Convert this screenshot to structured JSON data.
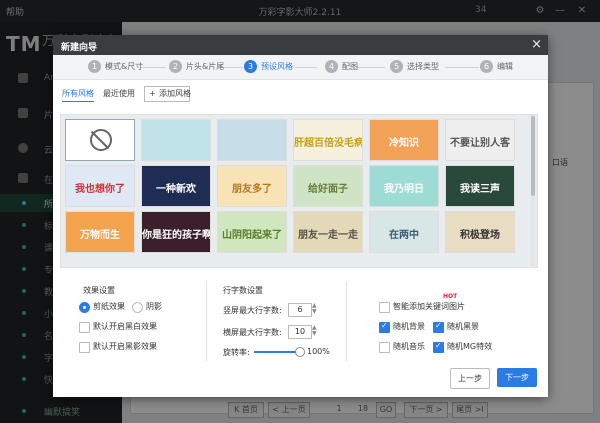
{
  "titlebar": {
    "menu": "帮助",
    "app_title": "万彩字影大师2.2.11",
    "account": "34"
  },
  "sidebar": {
    "logo": "TM",
    "logo_text": "万彩字影大师",
    "items": [
      {
        "label": "Ar"
      },
      {
        "label": "片"
      },
      {
        "label": "云"
      },
      {
        "label": "在"
      }
    ],
    "sub_items": [
      {
        "label": "所"
      },
      {
        "label": "标"
      },
      {
        "label": "课"
      },
      {
        "label": "专"
      },
      {
        "label": "教"
      },
      {
        "label": "小"
      },
      {
        "label": "名"
      },
      {
        "label": "字"
      },
      {
        "label": "快"
      },
      {
        "label": "幽默搞笑"
      }
    ]
  },
  "background": {
    "tag": "口语",
    "pager": {
      "first": "K 首页",
      "prev": "< 上一页",
      "page": "1",
      "total": "18",
      "go": "GO",
      "next": "下一页 >",
      "last": "尾页 >I"
    }
  },
  "dialog": {
    "title": "新建向导",
    "close": "×",
    "steps": [
      {
        "num": "1",
        "label": "模式&尺寸",
        "active": false
      },
      {
        "num": "2",
        "label": "片头&片尾",
        "active": false
      },
      {
        "num": "3",
        "label": "预设风格",
        "active": true
      },
      {
        "num": "4",
        "label": "配图",
        "active": false
      },
      {
        "num": "5",
        "label": "选择类型",
        "active": false
      },
      {
        "num": "6",
        "label": "编辑",
        "active": false
      }
    ],
    "tabs": {
      "all": "所有风格",
      "recent": "最近使用",
      "add": "添加风格",
      "add_icon": "+"
    },
    "thumbnails": [
      {
        "text": "",
        "bg": "#ffffff",
        "color": "#666",
        "none": true
      },
      {
        "text": "",
        "bg": "#bfe3e8",
        "color": "#466"
      },
      {
        "text": "",
        "bg": "#c7dde8",
        "color": "#466"
      },
      {
        "text": "肝超百倍没毛病",
        "bg": "#f6f1dc",
        "color": "#c7a017"
      },
      {
        "text": "冷知识",
        "bg": "#f2a257",
        "color": "#fff"
      },
      {
        "text": "不要让别人客",
        "bg": "#eeeeee",
        "color": "#555"
      },
      {
        "text": "我也想你了",
        "bg": "#dfe9f6",
        "color": "#c33"
      },
      {
        "text": "一种新欢",
        "bg": "#1f2d55",
        "color": "#fff"
      },
      {
        "text": "朋友多了",
        "bg": "#f8e3b6",
        "color": "#b57c1c"
      },
      {
        "text": "给好面子",
        "bg": "#cfe3c5",
        "color": "#6a7d3a"
      },
      {
        "text": "我乃明日",
        "bg": "#9ddcd4",
        "color": "#fff"
      },
      {
        "text": "我读三声",
        "bg": "#294a3b",
        "color": "#fff"
      },
      {
        "text": "万物而生",
        "bg": "#f3a24d",
        "color": "#fff"
      },
      {
        "text": "你是狂的孩子啊",
        "bg": "#3b1f2b",
        "color": "#fff"
      },
      {
        "text": "山阴阳起来了",
        "bg": "#cfe6bf",
        "color": "#5a7d2c"
      },
      {
        "text": "朋友一走一走",
        "bg": "#e3d8b8",
        "color": "#554"
      },
      {
        "text": "在两中",
        "bg": "#d9e6e6",
        "color": "#3a5a74"
      },
      {
        "text": "积极登场",
        "bg": "#e8dcc3",
        "color": "#333"
      }
    ],
    "effects": {
      "title": "效果设置",
      "paper_cut": "剪纸效果",
      "shadow": "阴影",
      "default_white": "默认开启黑白效果",
      "default_shadow": "默认开启黑影效果"
    },
    "lines": {
      "title": "行字数设置",
      "vertical_label": "竖屏最大行字数:",
      "vertical_value": "6",
      "horizontal_label": "横屏最大行字数:",
      "horizontal_value": "10",
      "rotation_label": "旋转率:",
      "rotation_value": "100%"
    },
    "smart": {
      "auto_keyword": "智能添加关键词图片",
      "hot": "HOT",
      "random_bg": "随机背景",
      "random_frame": "随机黑景",
      "random_music": "随机音乐",
      "random_mg": "随机MG特效"
    },
    "buttons": {
      "prev": "上一步",
      "next": "下一步"
    }
  }
}
